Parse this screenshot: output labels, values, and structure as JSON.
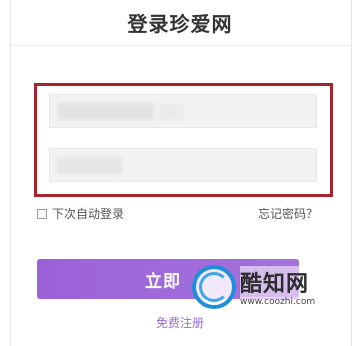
{
  "header": {
    "title": "登录珍爱网"
  },
  "form": {
    "username": {
      "value": "",
      "placeholder": ""
    },
    "password": {
      "value": "",
      "placeholder": ""
    },
    "remember_label": "下次自动登录",
    "remember_checked": false,
    "forgot_label": "忘记密码？",
    "login_label": "立即",
    "register_label": "免费注册"
  },
  "watermark": {
    "name": "酷知网",
    "url": "www.coozhi.com"
  },
  "colors": {
    "highlight": "#a4262c",
    "button": "#9b62d8",
    "link": "#9c6ad8",
    "watermark": "#1e8fd8"
  }
}
